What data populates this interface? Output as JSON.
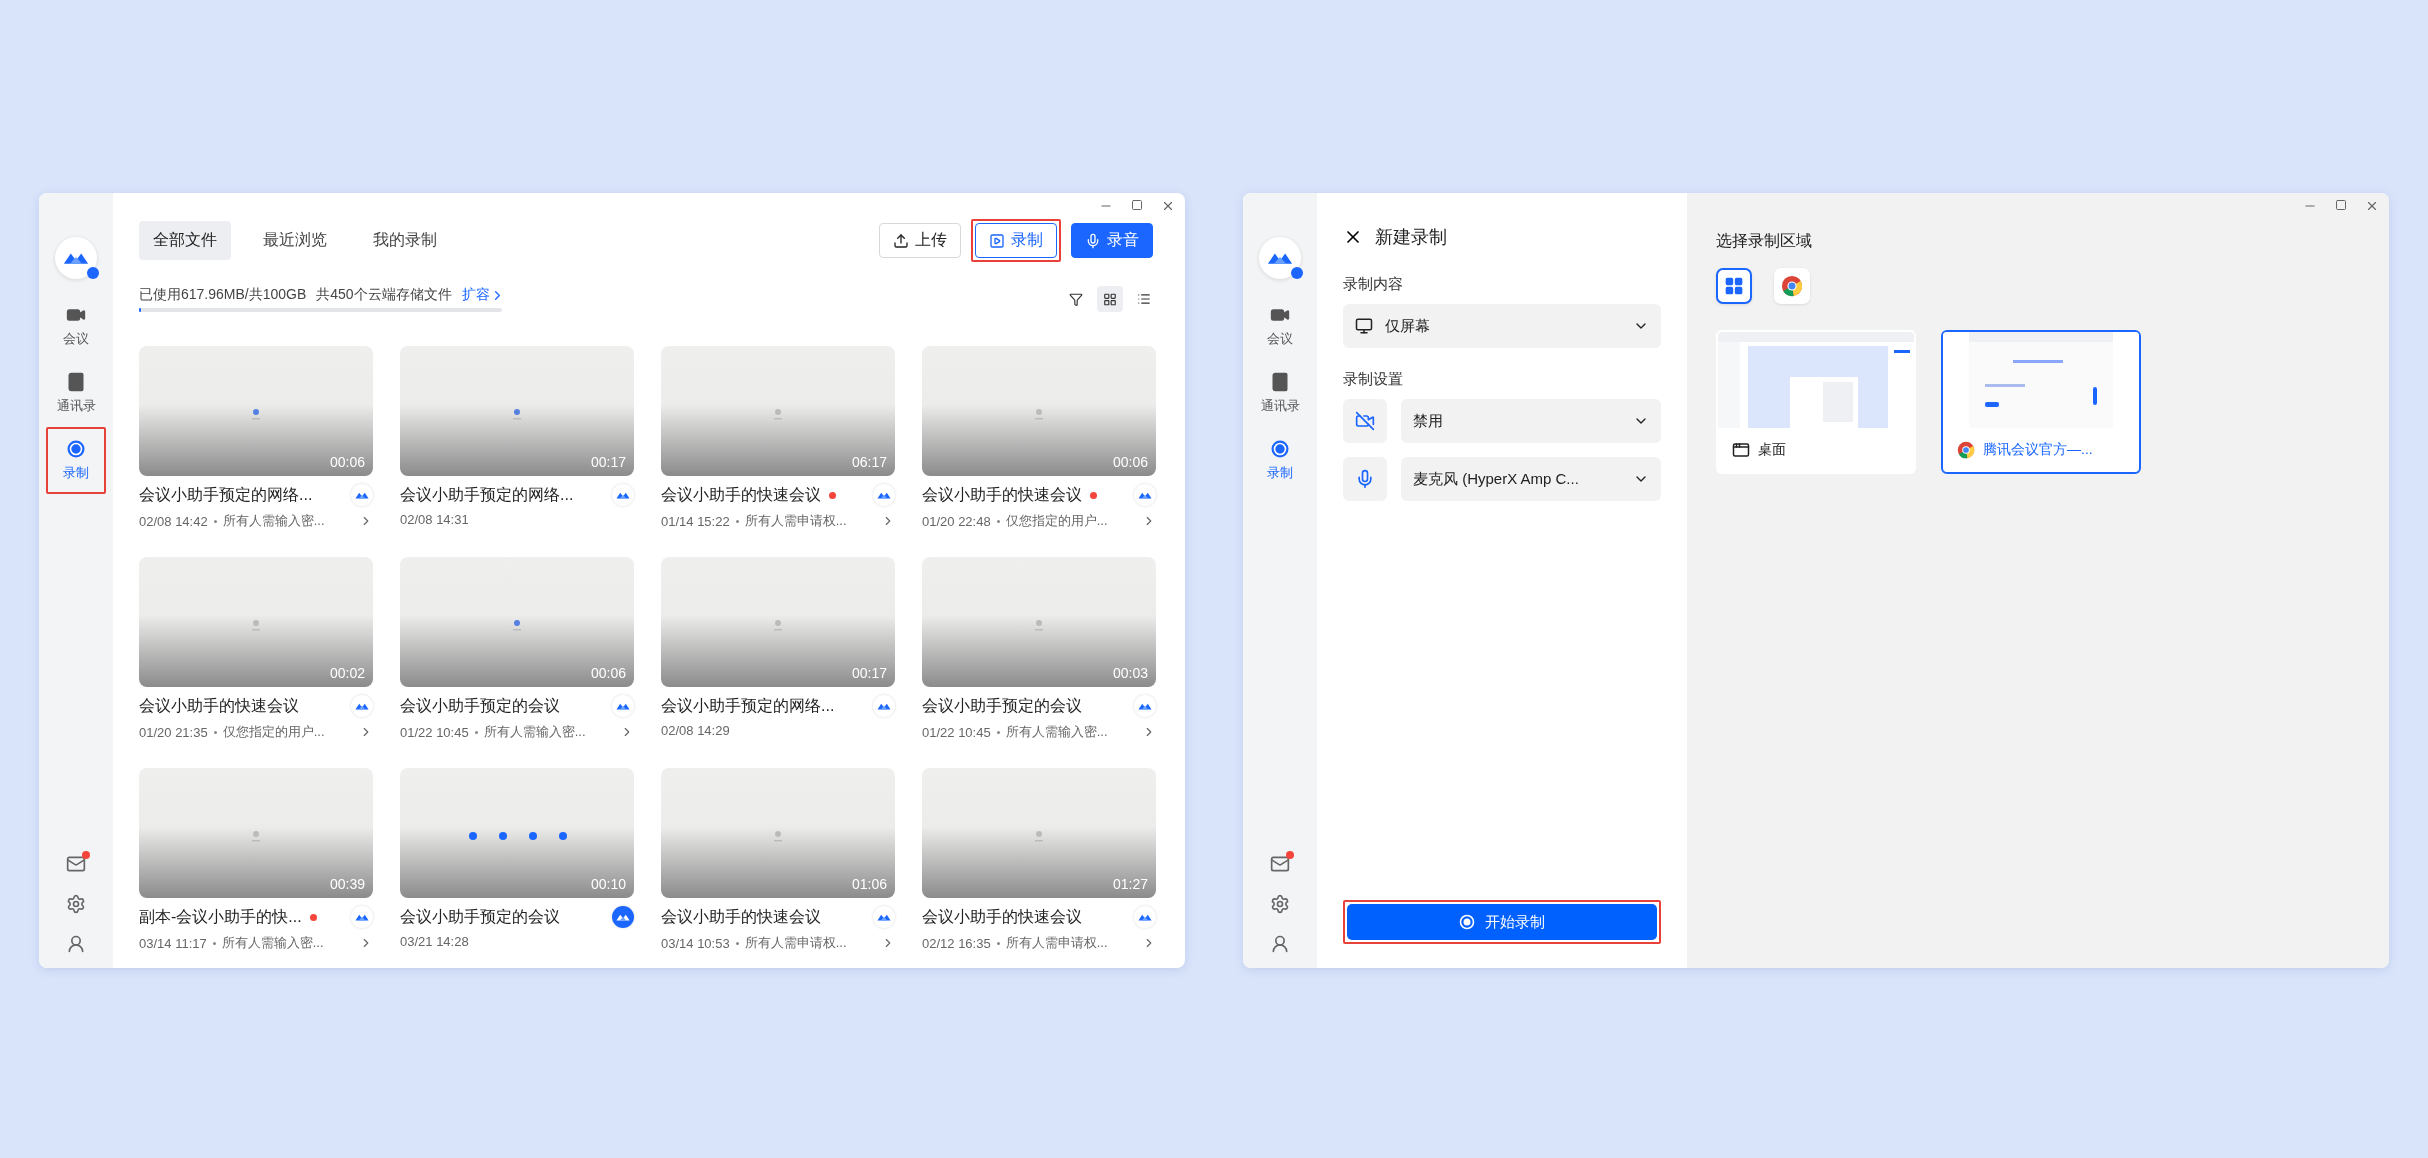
{
  "left_window": {
    "sidebar": {
      "items": [
        {
          "label": "会议",
          "kind": "meeting",
          "selected": false,
          "highlighted": false
        },
        {
          "label": "通讯录",
          "kind": "contacts",
          "selected": false,
          "highlighted": false
        },
        {
          "label": "录制",
          "kind": "record",
          "selected": true,
          "highlighted": true
        }
      ],
      "bottom_icons": [
        {
          "kind": "mail",
          "badge": true
        },
        {
          "kind": "settings",
          "badge": false
        },
        {
          "kind": "account",
          "badge": false
        }
      ]
    },
    "tabs": [
      {
        "label": "全部文件",
        "selected": true
      },
      {
        "label": "最近浏览",
        "selected": false
      },
      {
        "label": "我的录制",
        "selected": false
      }
    ],
    "actions": [
      {
        "label": "上传",
        "kind": "upload",
        "primary": false,
        "highlighted": false
      },
      {
        "label": "录制",
        "kind": "record",
        "primary": false,
        "highlighted": true
      },
      {
        "label": "录音",
        "kind": "audio",
        "primary": true,
        "highlighted": false
      }
    ],
    "storage": {
      "usage": "已使用617.96MB/共100GB",
      "count": "共450个云端存储文件",
      "link": "扩容",
      "level": 0.006
    },
    "view_modes": [
      {
        "kind": "grid",
        "selected": true
      },
      {
        "kind": "list",
        "selected": false
      }
    ],
    "recordings": [
      {
        "duration": "00:06",
        "title": "会议小助手预定的网络...",
        "date": "02/08 14:42",
        "access": "所有人需输入密...",
        "unread": false,
        "kind": "logo"
      },
      {
        "duration": "00:17",
        "title": "会议小助手预定的网络...",
        "date": "02/08 14:31",
        "unread": false,
        "kind": "logo"
      },
      {
        "duration": "06:17",
        "title": "会议小助手的快速会议",
        "date": "01/14 15:22",
        "access": "所有人需申请权...",
        "unread": true,
        "kind": "logo"
      },
      {
        "duration": "00:06",
        "title": "会议小助手的快速会议",
        "date": "01/20 22:48",
        "access": "仅您指定的用户...",
        "unread": true,
        "kind": "logo"
      },
      {
        "duration": "00:02",
        "title": "会议小助手的快速会议",
        "date": "01/20 21:35",
        "access": "仅您指定的用户...",
        "unread": false,
        "kind": "logo"
      },
      {
        "duration": "00:06",
        "title": "会议小助手预定的会议",
        "date": "01/22 10:45",
        "access": "所有人需输入密...",
        "unread": false,
        "kind": "logo"
      },
      {
        "duration": "00:17",
        "title": "会议小助手预定的网络...",
        "date": "02/08 14:29",
        "unread": false,
        "kind": "logo"
      },
      {
        "duration": "00:03",
        "title": "会议小助手预定的会议",
        "date": "01/22 10:45",
        "access": "所有人需输入密...",
        "unread": false,
        "kind": "logo"
      },
      {
        "duration": "00:39",
        "title": "副本-会议小助手的快...",
        "date": "03/14 11:17",
        "access": "所有人需输入密...",
        "unread": true,
        "kind": "logo"
      },
      {
        "duration": "00:10",
        "title": "会议小助手预定的会议",
        "date": "03/21 14:28",
        "unread": false,
        "kind": "app"
      },
      {
        "duration": "01:06",
        "title": "会议小助手的快速会议",
        "date": "03/14 10:53",
        "access": "所有人需申请权...",
        "unread": false,
        "kind": "logo"
      },
      {
        "duration": "01:27",
        "title": "会议小助手的快速会议",
        "date": "02/12 16:35",
        "access": "所有人需申请权...",
        "unread": false,
        "kind": "logo"
      }
    ]
  },
  "right_window": {
    "sidebar": {
      "items": [
        {
          "label": "会议",
          "kind": "meeting",
          "selected": false,
          "highlighted": false
        },
        {
          "label": "通讯录",
          "kind": "contacts",
          "selected": false,
          "highlighted": false
        },
        {
          "label": "录制",
          "kind": "record",
          "selected": true,
          "highlighted": false
        }
      ],
      "bottom_icons": [
        {
          "kind": "mail",
          "badge": true
        },
        {
          "kind": "settings",
          "badge": false
        },
        {
          "kind": "account",
          "badge": false
        }
      ]
    },
    "panel": {
      "title": "新建录制",
      "content_label": "录制内容",
      "content_value": "仅屏幕",
      "settings_label": "录制设置",
      "settings": [
        {
          "kind": "camera",
          "value": "禁用"
        },
        {
          "kind": "mic",
          "value": "麦克风 (HyperX Amp C..."
        }
      ],
      "start_button": {
        "label": "开始录制",
        "highlighted": true
      }
    },
    "area": {
      "title": "选择录制区域",
      "sources": [
        {
          "kind": "all",
          "selected": true
        },
        {
          "kind": "browser",
          "selected": false
        }
      ],
      "windows": [
        {
          "label": "桌面",
          "kind": "desktop",
          "selected": false
        },
        {
          "label": "腾讯会议官方—...",
          "kind": "browser",
          "selected": true
        }
      ]
    }
  }
}
